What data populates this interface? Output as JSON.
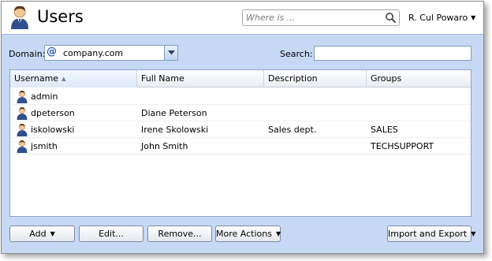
{
  "header": {
    "title": "Users",
    "where_placeholder": "Where is ...",
    "user_name": "R. Cul Powaro"
  },
  "filters": {
    "domain_label": "Domain:",
    "domain_value": "company.com",
    "search_label": "Search:",
    "search_value": ""
  },
  "table": {
    "columns": [
      "Username",
      "Full Name",
      "Description",
      "Groups"
    ],
    "sorted_column": "Username",
    "rows": [
      {
        "username": "admin",
        "full_name": "",
        "description": "",
        "groups": ""
      },
      {
        "username": "dpeterson",
        "full_name": "Diane Peterson",
        "description": "",
        "groups": ""
      },
      {
        "username": "iskolowski",
        "full_name": "Irene Skolowski",
        "description": "Sales dept.",
        "groups": "SALES"
      },
      {
        "username": "jsmith",
        "full_name": "John Smith",
        "description": "",
        "groups": "TECHSUPPORT"
      }
    ]
  },
  "toolbar": {
    "add_label": "Add",
    "edit_label": "Edit...",
    "remove_label": "Remove...",
    "more_actions_label": "More Actions",
    "import_export_label": "Import and Export"
  },
  "colors": {
    "panel_background": "#c6d8f4",
    "accent": "#2a5db0"
  },
  "icons": {
    "header": "users-icon",
    "where_search": "search-icon",
    "domain": "at-sign-icon",
    "row": "user-icon"
  }
}
